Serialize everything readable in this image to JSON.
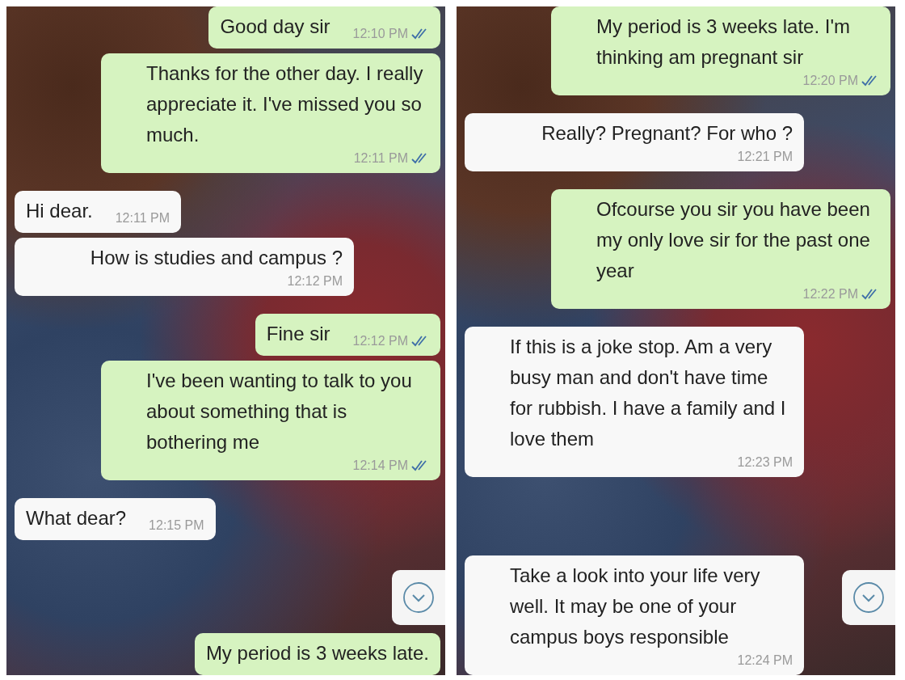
{
  "panels": [
    {
      "messages": [
        {
          "kind": "sent",
          "text": "Good day sir",
          "time": "12:10 PM",
          "read": true
        },
        {
          "kind": "sent",
          "text": "Thanks for the other day. I really appreciate it. I've missed you so much.",
          "time": "12:11 PM",
          "read": true
        },
        {
          "kind": "received",
          "text": "Hi dear.",
          "time": "12:11 PM"
        },
        {
          "kind": "received",
          "text": "How is studies and campus ?",
          "time": "12:12 PM"
        },
        {
          "kind": "sent",
          "text": "Fine sir",
          "time": "12:12 PM",
          "read": true
        },
        {
          "kind": "sent",
          "text": "I've been wanting to talk to you about something that is bothering me",
          "time": "12:14 PM",
          "read": true
        },
        {
          "kind": "received",
          "text": "What dear?",
          "time": "12:15 PM"
        },
        {
          "kind": "sent",
          "text": "My period is 3 weeks late."
        }
      ]
    },
    {
      "messages": [
        {
          "kind": "sent",
          "text": "My period is 3 weeks late. I'm thinking am pregnant sir",
          "time": "12:20 PM",
          "read": true
        },
        {
          "kind": "received",
          "text": "Really? Pregnant? For who ?",
          "time": "12:21 PM"
        },
        {
          "kind": "sent",
          "text": "Ofcourse you sir you have been my only love sir for the past one year",
          "time": "12:22 PM",
          "read": true
        },
        {
          "kind": "received",
          "text": "If this is a joke stop. Am a very busy man and don't have time for rubbish. I have a family and I love them",
          "time": "12:23 PM"
        },
        {
          "kind": "received",
          "text": "Take a look into your life very well. It may be one of your campus boys responsible",
          "time": "12:24 PM"
        }
      ]
    }
  ]
}
